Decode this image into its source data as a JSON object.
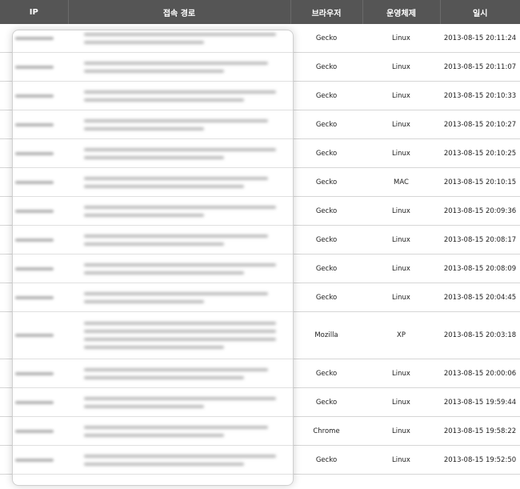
{
  "headers": {
    "ip": "IP",
    "path": "접속 경로",
    "browser": "브라우저",
    "os": "운영체제",
    "date": "일시"
  },
  "rows": [
    {
      "browser": "Gecko",
      "os": "Linux",
      "date": "2013-08-15 20:11:24",
      "path_lines": 2
    },
    {
      "browser": "Gecko",
      "os": "Linux",
      "date": "2013-08-15 20:11:07",
      "path_lines": 2
    },
    {
      "browser": "Gecko",
      "os": "Linux",
      "date": "2013-08-15 20:10:33",
      "path_lines": 2
    },
    {
      "browser": "Gecko",
      "os": "Linux",
      "date": "2013-08-15 20:10:27",
      "path_lines": 2
    },
    {
      "browser": "Gecko",
      "os": "Linux",
      "date": "2013-08-15 20:10:25",
      "path_lines": 2
    },
    {
      "browser": "Gecko",
      "os": "MAC",
      "date": "2013-08-15 20:10:15",
      "path_lines": 2
    },
    {
      "browser": "Gecko",
      "os": "Linux",
      "date": "2013-08-15 20:09:36",
      "path_lines": 2
    },
    {
      "browser": "Gecko",
      "os": "Linux",
      "date": "2013-08-15 20:08:17",
      "path_lines": 2
    },
    {
      "browser": "Gecko",
      "os": "Linux",
      "date": "2013-08-15 20:08:09",
      "path_lines": 2
    },
    {
      "browser": "Gecko",
      "os": "Linux",
      "date": "2013-08-15 20:04:45",
      "path_lines": 2
    },
    {
      "browser": "Mozilla",
      "os": "XP",
      "date": "2013-08-15 20:03:18",
      "path_lines": 4,
      "tall": true
    },
    {
      "browser": "Gecko",
      "os": "Linux",
      "date": "2013-08-15 20:00:06",
      "path_lines": 2
    },
    {
      "browser": "Gecko",
      "os": "Linux",
      "date": "2013-08-15 19:59:44",
      "path_lines": 2
    },
    {
      "browser": "Chrome",
      "os": "Linux",
      "date": "2013-08-15 19:58:22",
      "path_lines": 2
    },
    {
      "browser": "Gecko",
      "os": "Linux",
      "date": "2013-08-15 19:52:50",
      "path_lines": 2
    }
  ],
  "colors": {
    "header_bg": "#555555",
    "header_text": "#ffffff",
    "row_border": "#d6d6d6"
  }
}
